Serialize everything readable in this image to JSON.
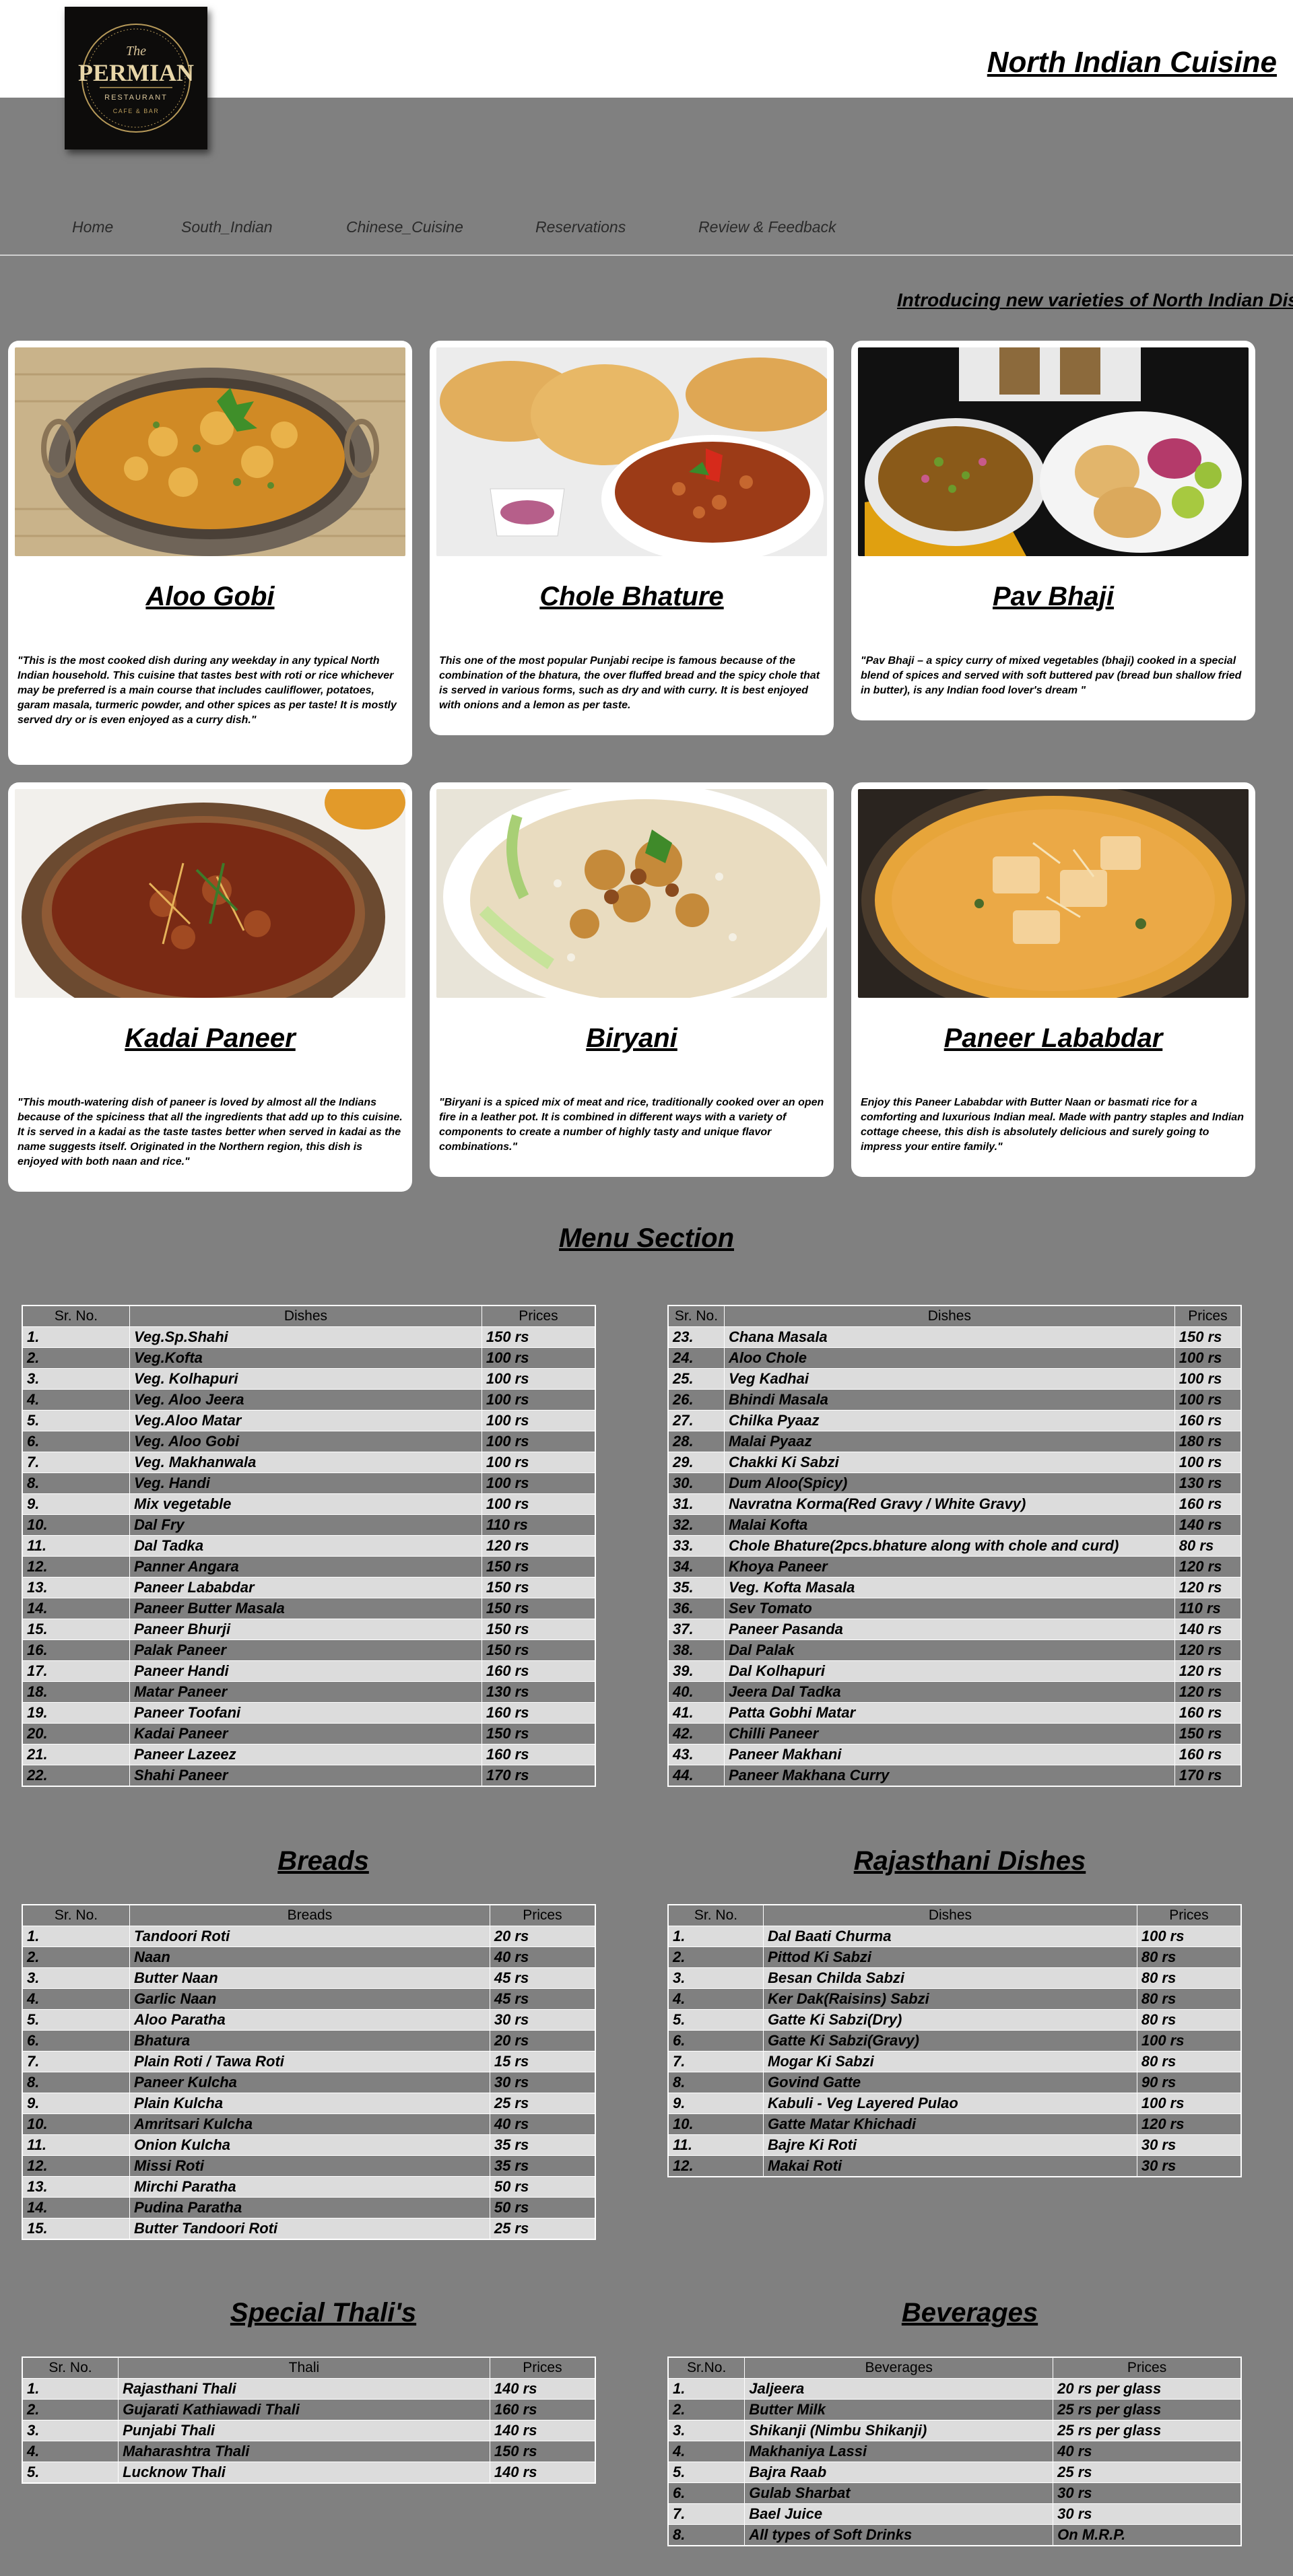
{
  "header": {
    "logo_text_top": "The",
    "logo_text_main": "PERMIAN",
    "logo_text_sub": "RESTAURANT",
    "logo_text_bottom": "CAFE & BAR",
    "site_title": "North  Indian  Cuisine"
  },
  "nav": {
    "items": [
      "Home",
      "South_Indian",
      "Chinese_Cuisine",
      "Reservations",
      "Review & Feedback"
    ]
  },
  "marquee": "Introducing new varieties of North Indian Dishes",
  "cards": [
    {
      "title": "Aloo Gobi",
      "desc": "\"This is the most cooked dish during any weekday in any typical North Indian household. This cuisine that tastes best with roti or rice whichever may be preferred is a main course that includes cauliflower, potatoes, garam masala, turmeric powder, and other spices as per taste! It is mostly served dry or is even enjoyed as a curry dish.\""
    },
    {
      "title": "Chole Bhature",
      "desc": "This one of the most popular Punjabi recipe is famous because of the combination of the bhatura, the over fluffed bread and the spicy chole that is served in various forms, such as dry and with curry. It is best enjoyed with onions and a lemon as per taste."
    },
    {
      "title": "Pav Bhaji",
      "desc": "\"Pav Bhaji – a spicy curry of mixed vegetables (bhaji) cooked in a special blend of spices and served with soft buttered pav (bread bun shallow fried in butter), is any Indian food lover's dream \""
    },
    {
      "title": "Kadai Paneer",
      "desc": "\"This mouth-watering dish of paneer is loved by almost all the Indians because of the spiciness that all the ingredients that add up to this cuisine. It is served in a kadai as the taste tastes better when served in kadai as the name suggests itself. Originated in the Northern region, this dish is enjoyed with both naan and rice.\""
    },
    {
      "title": "Biryani",
      "desc": "\"Biryani is a spiced mix of meat and rice, traditionally cooked over an open fire in a leather pot. It is combined in different ways with a variety of components to create a number of highly tasty and unique flavor combinations.\""
    },
    {
      "title": "Paneer Lababdar",
      "desc": "Enjoy this Paneer Lababdar with Butter Naan or basmati rice for a comforting and luxurious Indian meal. Made with pantry staples and Indian cottage cheese, this dish is absolutely delicious and surely going to impress your entire family.\""
    }
  ],
  "menu_section": {
    "title": "Menu Section",
    "headers": [
      "Sr. No.",
      "Dishes",
      "Prices"
    ],
    "left_rows": [
      [
        "1.",
        "Veg.Sp.Shahi",
        "150 rs"
      ],
      [
        "2.",
        "Veg.Kofta",
        "100 rs"
      ],
      [
        "3.",
        "Veg. Kolhapuri",
        "100 rs"
      ],
      [
        "4.",
        "Veg. Aloo Jeera",
        "100 rs"
      ],
      [
        "5.",
        "Veg.Aloo Matar",
        "100 rs"
      ],
      [
        "6.",
        "Veg. Aloo Gobi",
        "100 rs"
      ],
      [
        "7.",
        "Veg. Makhanwala",
        "100 rs"
      ],
      [
        "8.",
        "Veg. Handi",
        "100 rs"
      ],
      [
        "9.",
        "Mix vegetable",
        "100 rs"
      ],
      [
        "10.",
        "Dal Fry",
        "110 rs"
      ],
      [
        "11.",
        "Dal Tadka",
        "120 rs"
      ],
      [
        "12.",
        "Panner Angara",
        "150 rs"
      ],
      [
        "13.",
        "Paneer Lababdar",
        "150 rs"
      ],
      [
        "14.",
        "Paneer Butter Masala",
        "150 rs"
      ],
      [
        "15.",
        "Paneer Bhurji",
        "150 rs"
      ],
      [
        "16.",
        "Palak Paneer",
        "150 rs"
      ],
      [
        "17.",
        "Paneer Handi",
        "160 rs"
      ],
      [
        "18.",
        "Matar Paneer",
        "130 rs"
      ],
      [
        "19.",
        "Paneer Toofani",
        "160 rs"
      ],
      [
        "20.",
        "Kadai Paneer",
        "150 rs"
      ],
      [
        "21.",
        "Paneer Lazeez",
        "160 rs"
      ],
      [
        "22.",
        "Shahi Paneer",
        "170 rs"
      ]
    ],
    "right_rows": [
      [
        "23.",
        "Chana Masala",
        "150 rs"
      ],
      [
        "24.",
        "Aloo Chole",
        "100 rs"
      ],
      [
        "25.",
        "Veg Kadhai",
        "100 rs"
      ],
      [
        "26.",
        "Bhindi Masala",
        "100 rs"
      ],
      [
        "27.",
        "Chilka Pyaaz",
        "160 rs"
      ],
      [
        "28.",
        "Malai Pyaaz",
        "180 rs"
      ],
      [
        "29.",
        "Chakki Ki Sabzi",
        "100 rs"
      ],
      [
        "30.",
        "Dum Aloo(Spicy)",
        "130 rs"
      ],
      [
        "31.",
        "Navratna Korma(Red Gravy / White Gravy)",
        "160 rs"
      ],
      [
        "32.",
        "Malai Kofta",
        "140 rs"
      ],
      [
        "33.",
        "Chole Bhature(2pcs.bhature along with chole and curd)",
        "80 rs"
      ],
      [
        "34.",
        "Khoya Paneer",
        "120 rs"
      ],
      [
        "35.",
        "Veg. Kofta Masala",
        "120 rs"
      ],
      [
        "36.",
        "Sev Tomato",
        "110 rs"
      ],
      [
        "37.",
        "Paneer Pasanda",
        "140 rs"
      ],
      [
        "38.",
        "Dal Palak",
        "120 rs"
      ],
      [
        "39.",
        "Dal Kolhapuri",
        "120 rs"
      ],
      [
        "40.",
        "Jeera Dal Tadka",
        "120 rs"
      ],
      [
        "41.",
        "Patta Gobhi Matar",
        "160 rs"
      ],
      [
        "42.",
        "Chilli Paneer",
        "150 rs"
      ],
      [
        "43.",
        "Paneer Makhani",
        "160 rs"
      ],
      [
        "44.",
        "Paneer Makhana Curry",
        "170 rs"
      ]
    ]
  },
  "breads": {
    "title": "Breads",
    "headers": [
      "Sr. No.",
      "Breads",
      "Prices"
    ],
    "rows": [
      [
        "1.",
        "Tandoori Roti",
        "20 rs"
      ],
      [
        "2.",
        "Naan",
        "40 rs"
      ],
      [
        "3.",
        "Butter Naan",
        "45 rs"
      ],
      [
        "4.",
        "Garlic Naan",
        "45 rs"
      ],
      [
        "5.",
        "Aloo Paratha",
        "30 rs"
      ],
      [
        "6.",
        "Bhatura",
        "20 rs"
      ],
      [
        "7.",
        "Plain Roti / Tawa Roti",
        "15 rs"
      ],
      [
        "8.",
        "Paneer Kulcha",
        "30 rs"
      ],
      [
        "9.",
        "Plain Kulcha",
        "25 rs"
      ],
      [
        "10.",
        "Amritsari Kulcha",
        "40 rs"
      ],
      [
        "11.",
        "Onion Kulcha",
        "35 rs"
      ],
      [
        "12.",
        "Missi Roti",
        "35 rs"
      ],
      [
        "13.",
        "Mirchi Paratha",
        "50 rs"
      ],
      [
        "14.",
        "Pudina Paratha",
        "50 rs"
      ],
      [
        "15.",
        "Butter Tandoori Roti",
        "25 rs"
      ]
    ]
  },
  "rajasthani": {
    "title": "Rajasthani Dishes",
    "headers": [
      "Sr. No.",
      "Dishes",
      "Prices"
    ],
    "rows": [
      [
        "1.",
        "Dal Baati Churma",
        "100 rs"
      ],
      [
        "2.",
        "Pittod Ki Sabzi",
        "80 rs"
      ],
      [
        "3.",
        "Besan Childa Sabzi",
        "80 rs"
      ],
      [
        "4.",
        "Ker Dak(Raisins) Sabzi",
        "80 rs"
      ],
      [
        "5.",
        "Gatte Ki Sabzi(Dry)",
        "80 rs"
      ],
      [
        "6.",
        "Gatte Ki Sabzi(Gravy)",
        "100 rs"
      ],
      [
        "7.",
        "Mogar Ki Sabzi",
        "80 rs"
      ],
      [
        "8.",
        "Govind Gatte",
        "90 rs"
      ],
      [
        "9.",
        "Kabuli - Veg Layered Pulao",
        "100 rs"
      ],
      [
        "10.",
        "Gatte Matar Khichadi",
        "120 rs"
      ],
      [
        "11.",
        "Bajre Ki Roti",
        "30 rs"
      ],
      [
        "12.",
        "Makai Roti",
        "30 rs"
      ]
    ]
  },
  "thali": {
    "title": "Special Thali's",
    "headers": [
      "Sr. No.",
      "Thali",
      "Prices"
    ],
    "rows": [
      [
        "1.",
        "Rajasthani Thali",
        "140 rs"
      ],
      [
        "2.",
        "Gujarati Kathiawadi Thali",
        "160 rs"
      ],
      [
        "3.",
        "Punjabi Thali",
        "140 rs"
      ],
      [
        "4.",
        "Maharashtra Thali",
        "150 rs"
      ],
      [
        "5.",
        "Lucknow Thali",
        "140 rs"
      ]
    ]
  },
  "beverages": {
    "title": "Beverages",
    "headers": [
      "Sr.No.",
      "Beverages",
      "Prices"
    ],
    "rows": [
      [
        "1.",
        "Jaljeera",
        "20 rs per glass"
      ],
      [
        "2.",
        "Butter Milk",
        "25 rs per glass"
      ],
      [
        "3.",
        "Shikanji (Nimbu Shikanji)",
        "25 rs per glass"
      ],
      [
        "4.",
        "Makhaniya Lassi",
        "40 rs"
      ],
      [
        "5.",
        "Bajra Raab",
        "25 rs"
      ],
      [
        "6.",
        "Gulab Sharbat",
        "30 rs"
      ],
      [
        "7.",
        "Bael Juice",
        "30 rs"
      ],
      [
        "8.",
        "All types of Soft Drinks",
        "On M.R.P."
      ]
    ]
  }
}
